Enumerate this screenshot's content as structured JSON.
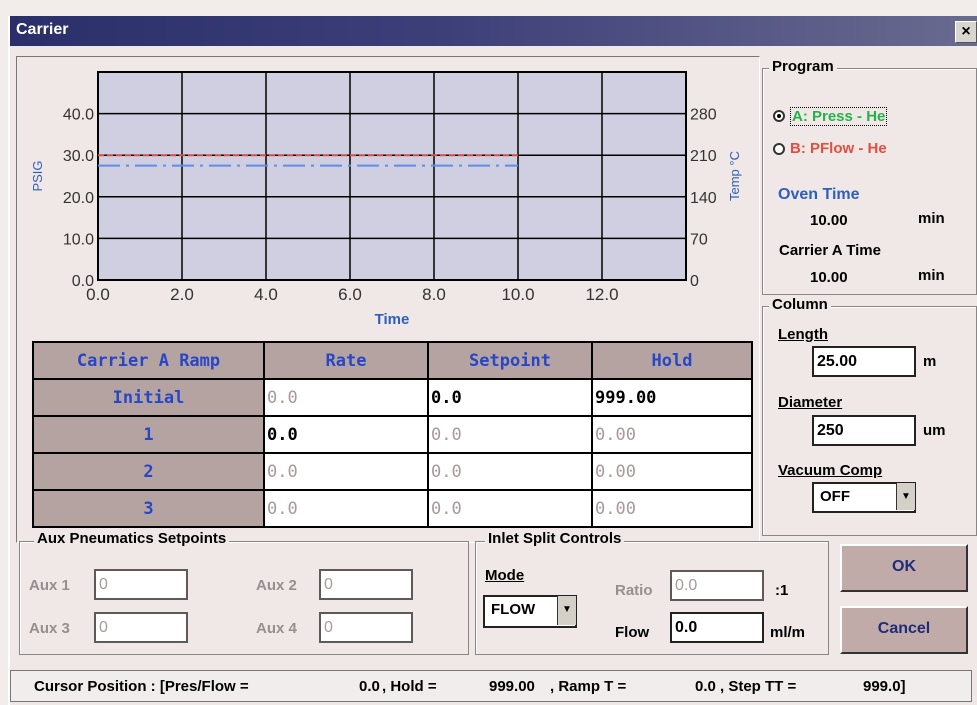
{
  "window": {
    "title": "Carrier",
    "close_label": "×"
  },
  "chart_data": {
    "type": "line",
    "xlabel": "Time",
    "ylabel": "PSIG",
    "y2label": "Temp °C",
    "xlim": [
      0,
      14
    ],
    "ylim": [
      0,
      50
    ],
    "y2lim": [
      0,
      350
    ],
    "x_ticks": [
      "0.0",
      "2.0",
      "4.0",
      "6.0",
      "8.0",
      "10.0",
      "12.0"
    ],
    "y_ticks": [
      "0.0",
      "10.0",
      "20.0",
      "30.0",
      "40.0"
    ],
    "y2_ticks": [
      "0",
      "70",
      "140",
      "210",
      "280"
    ],
    "grid": true,
    "series": [
      {
        "x": [
          0,
          10
        ],
        "y": [
          30,
          30
        ],
        "color": "#e14a3c"
      },
      {
        "x": [
          0,
          10
        ],
        "y": [
          27.5,
          27.5
        ],
        "color": "#5d8de8"
      }
    ]
  },
  "ramp_table": {
    "headers": [
      "Carrier A Ramp",
      "Rate",
      "Setpoint",
      "Hold"
    ],
    "rows": [
      {
        "label": "Initial",
        "rate": "0.0",
        "setpoint": "0.0",
        "hold": "999.00"
      },
      {
        "label": "1",
        "rate": "0.0",
        "setpoint": "0.0",
        "hold": "0.00"
      },
      {
        "label": "2",
        "rate": "0.0",
        "setpoint": "0.0",
        "hold": "0.00"
      },
      {
        "label": "3",
        "rate": "0.0",
        "setpoint": "0.0",
        "hold": "0.00"
      }
    ]
  },
  "program": {
    "title": "Program",
    "option_a": "A: Press - He",
    "option_b": "B: PFlow - He",
    "oven_time_label": "Oven Time",
    "oven_time_value": "10.00",
    "oven_time_unit": "min",
    "carrier_time_label": "Carrier A Time",
    "carrier_time_value": "10.00",
    "carrier_time_unit": "min",
    "colors": {
      "option_a": "#25b24a",
      "option_b": "#e24e40",
      "blue_label": "#2f5fbc"
    }
  },
  "column": {
    "title": "Column",
    "length_label": "Length",
    "length_value": "25.00",
    "length_unit": "m",
    "diameter_label": "Diameter",
    "diameter_value": "250",
    "diameter_unit": "um",
    "vacuum_label": "Vacuum Comp",
    "vacuum_value": "OFF"
  },
  "aux": {
    "title": "Aux Pneumatics Setpoints",
    "aux1_label": "Aux 1",
    "aux1_value": "0",
    "aux2_label": "Aux 2",
    "aux2_value": "0",
    "aux3_label": "Aux 3",
    "aux3_value": "0",
    "aux4_label": "Aux 4",
    "aux4_value": "0"
  },
  "inlet": {
    "title": "Inlet Split Controls",
    "mode_label": "Mode",
    "mode_value": "FLOW",
    "ratio_label": "Ratio",
    "ratio_value": "0.0",
    "ratio_unit": ":1",
    "flow_label": "Flow",
    "flow_value": "0.0",
    "flow_unit": "ml/m"
  },
  "buttons": {
    "ok": "OK",
    "cancel": "Cancel"
  },
  "status": {
    "prefix": "Cursor Position : [Pres/Flow =",
    "pres_flow": "0.0",
    "hold_label": ", Hold =",
    "hold_value": "999.00",
    "ramp_label": ", Ramp T =",
    "ramp_value": "0.0",
    "step_label": ", Step TT =",
    "step_value": "999.0]"
  }
}
